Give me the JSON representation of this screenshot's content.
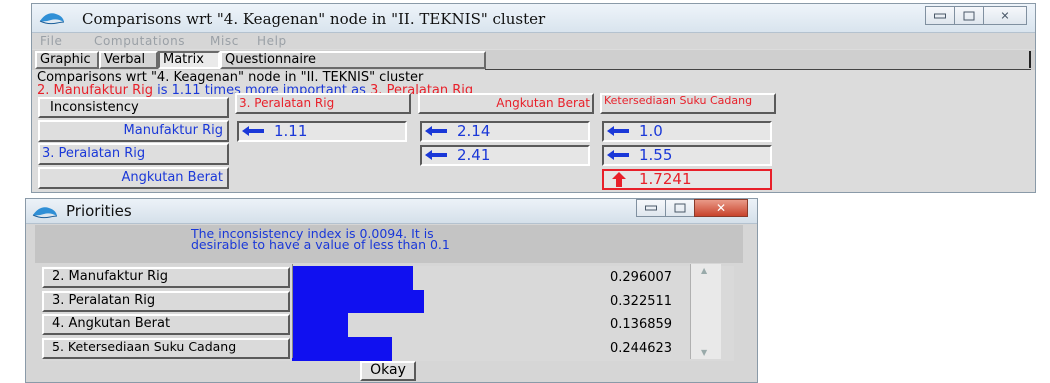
{
  "main_window": {
    "title": "Comparisons wrt \"4. Keagenan\" node in \"II. TEKNIS\" cluster",
    "menu": [
      "File",
      "Computations",
      "Misc",
      "Help"
    ],
    "tabs": [
      "Graphic",
      "Verbal",
      "Matrix",
      "Questionnaire"
    ],
    "active_tab": "Matrix",
    "info_line1": "Comparisons wrt \"4. Keagenan\" node in \"II. TEKNIS\" cluster",
    "info_line2": {
      "part1": "2. Manufaktur Rig",
      "part2": " is 1.11 times more important as ",
      "part3": "3. Peralatan Rig"
    },
    "inconsistency_button": "Inconsistency",
    "col_headers": [
      "3. Peralatan Rig",
      "Angkutan Berat",
      "Ketersediaan Suku Cadang"
    ],
    "row_headers": [
      "Manufaktur Rig",
      "3. Peralatan Rig",
      "Angkutan Berat"
    ],
    "cells": {
      "r1c1": "1.11",
      "r1c2": "2.14",
      "r1c3": "1.0",
      "r2c2": "2.41",
      "r2c3": "1.55",
      "r3c3": "1.7241"
    }
  },
  "priorities_window": {
    "title": "Priorities",
    "message": "The inconsistency index is 0.0094.  It is desirable to have a value of less than 0.1",
    "items": [
      {
        "label": "2. Manufaktur Rig",
        "value": "0.296007",
        "weight": 0.296007
      },
      {
        "label": "3. Peralatan Rig",
        "value": "0.322511",
        "weight": 0.322511
      },
      {
        "label": "4. Angkutan Berat",
        "value": "0.136859",
        "weight": 0.136859
      },
      {
        "label": "5. Ketersediaan Suku Cadang",
        "value": "0.244623",
        "weight": 0.244623
      }
    ],
    "ok_label": "Okay"
  },
  "colors": {
    "accent_blue": "#1a38d8",
    "highlight_red": "#e8202a",
    "bar_blue": "#1010f0"
  }
}
